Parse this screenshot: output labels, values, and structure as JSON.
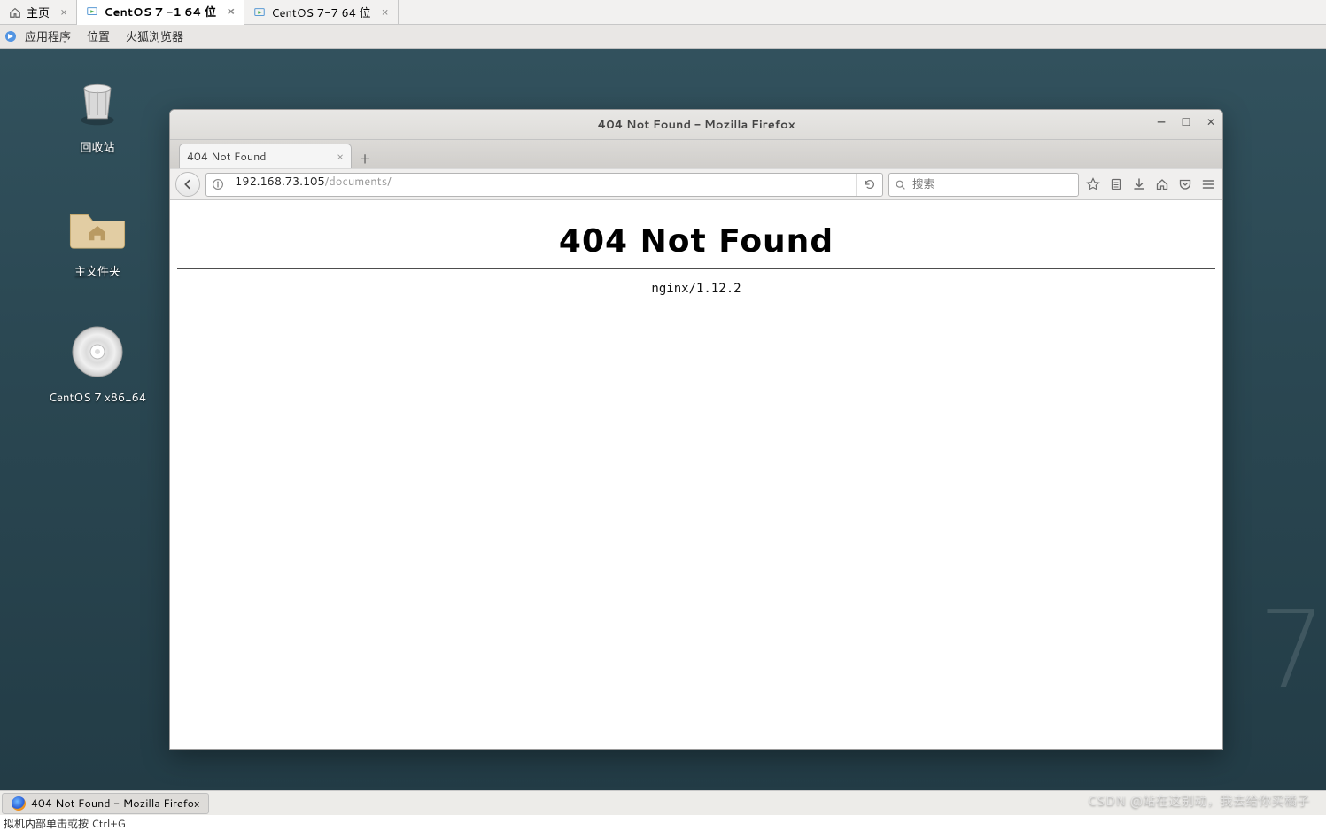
{
  "host": {
    "tabs": [
      {
        "label": "主页"
      },
      {
        "label": "CentOS 7 -1 64 位"
      },
      {
        "label": "CentOS 7-7  64 位"
      }
    ],
    "active_tab_index": 1
  },
  "gnome": {
    "menu": {
      "apps": "应用程序",
      "places": "位置",
      "firefox": "火狐浏览器"
    },
    "desktop_icons": {
      "trash": "回收站",
      "home": "主文件夹",
      "cd": "CentOS 7 x86_64"
    },
    "taskbar": {
      "active_window": "404 Not Found - Mozilla Firefox"
    },
    "status_hint": "拟机内部单击或按 Ctrl+G"
  },
  "firefox": {
    "window_title": "404 Not Found - Mozilla Firefox",
    "tab_label": "404 Not Found",
    "url_host": "192.168.73.105",
    "url_path": "/documents/",
    "search_placeholder": "搜索",
    "page": {
      "heading": "404 Not Found",
      "server": "nginx/1.12.2"
    }
  },
  "watermark": "CSDN @站在这别动，我去给你买橘子"
}
